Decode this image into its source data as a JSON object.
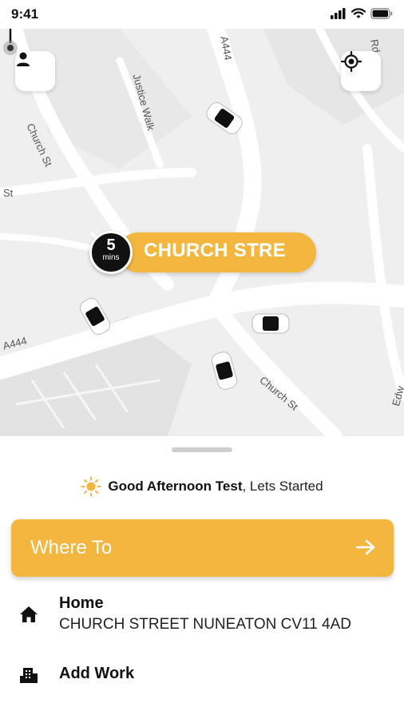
{
  "status_bar": {
    "time": "9:41"
  },
  "map": {
    "street_labels": [
      "A444",
      "Justice Walk",
      "Church St",
      "St",
      "A444",
      "Church St",
      "Rd",
      "Edw"
    ],
    "pickup": {
      "eta_value": "5",
      "eta_unit": "mins",
      "location": "CHURCH STRE"
    },
    "icons": {
      "profile": "person-icon",
      "locate": "crosshair-icon"
    }
  },
  "sheet": {
    "greeting_bold": "Good Afternoon Test",
    "greeting_rest": ", Lets Started",
    "where_to": "Where To",
    "saved_places": [
      {
        "icon": "home-icon",
        "title": "Home",
        "address": "CHURCH STREET NUNEATON CV11 4AD"
      },
      {
        "icon": "work-icon",
        "title": "Add Work"
      }
    ]
  },
  "colors": {
    "accent": "#f3b73f",
    "map_bg": "#efefef",
    "dark": "#111111"
  }
}
